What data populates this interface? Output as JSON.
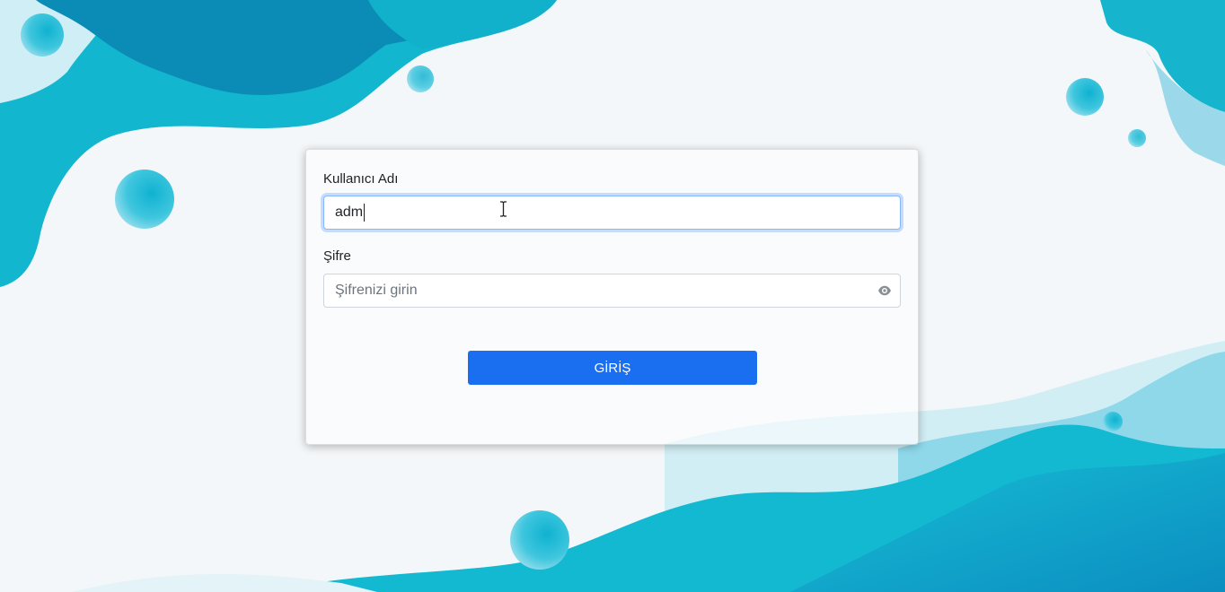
{
  "form": {
    "username_label": "Kullanıcı Adı",
    "username_value": "adm",
    "password_label": "Şifre",
    "password_placeholder": "Şifrenizi girin",
    "submit_label": "GİRİŞ"
  },
  "icons": {
    "password_toggle": "eye-icon",
    "cursor": "text-cursor-icon"
  },
  "colors": {
    "primary_button": "#1a6ef0",
    "wave_dark": "#0a8fb8",
    "wave_mid": "#12b8d0",
    "wave_light": "#8fdbeb"
  }
}
